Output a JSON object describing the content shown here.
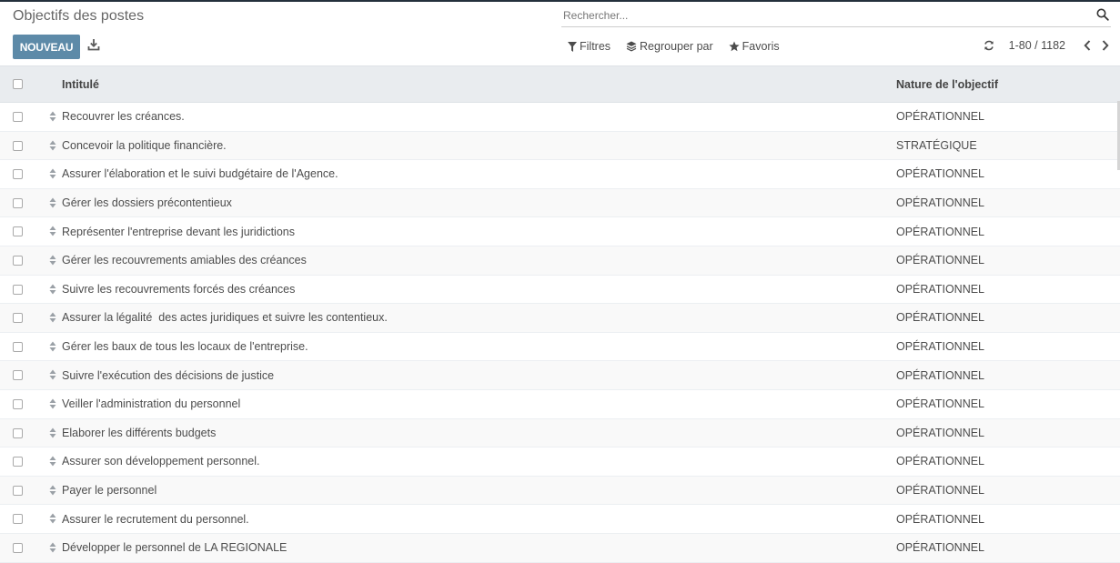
{
  "page": {
    "title": "Objectifs des postes"
  },
  "search": {
    "placeholder": "Rechercher..."
  },
  "toolbar": {
    "new_label": "NOUVEAU"
  },
  "filters": {
    "filters_label": "Filtres",
    "group_label": "Regrouper par",
    "favorites_label": "Favoris"
  },
  "pager": {
    "range": "1-80 / 1182"
  },
  "table": {
    "col_title": "Intitulé",
    "col_nature": "Nature de l'objectif",
    "rows": [
      {
        "title": "Recouvrer les créances.",
        "nature": "OPÉRATIONNEL"
      },
      {
        "title": "Concevoir la politique financière.",
        "nature": "STRATÉGIQUE"
      },
      {
        "title": "Assurer l'élaboration et le suivi budgétaire de l'Agence.",
        "nature": "OPÉRATIONNEL"
      },
      {
        "title": "Gérer les dossiers précontentieux",
        "nature": "OPÉRATIONNEL"
      },
      {
        "title": "Représenter l'entreprise devant les juridictions",
        "nature": "OPÉRATIONNEL"
      },
      {
        "title": "Gérer les recouvrements amiables des créances",
        "nature": "OPÉRATIONNEL"
      },
      {
        "title": "Suivre les recouvrements forcés des créances",
        "nature": "OPÉRATIONNEL"
      },
      {
        "title": "Assurer la légalité  des actes juridiques et suivre les contentieux.",
        "nature": "OPÉRATIONNEL"
      },
      {
        "title": "Gérer les baux de tous les locaux de l'entreprise.",
        "nature": "OPÉRATIONNEL"
      },
      {
        "title": "Suivre l'exécution des décisions de justice",
        "nature": "OPÉRATIONNEL"
      },
      {
        "title": "Veiller l'administration du personnel",
        "nature": "OPÉRATIONNEL"
      },
      {
        "title": "Elaborer les différents budgets",
        "nature": "OPÉRATIONNEL"
      },
      {
        "title": "Assurer son développement personnel.",
        "nature": "OPÉRATIONNEL"
      },
      {
        "title": "Payer le personnel",
        "nature": "OPÉRATIONNEL"
      },
      {
        "title": "Assurer le recrutement du personnel.",
        "nature": "OPÉRATIONNEL"
      },
      {
        "title": "Développer le personnel de LA REGIONALE",
        "nature": "OPÉRATIONNEL"
      }
    ]
  },
  "icons": {
    "search": "search-icon",
    "download": "download-icon",
    "filter": "funnel-icon",
    "group": "layers-icon",
    "favorites": "star-icon",
    "reload": "refresh-icon",
    "prev": "chevron-left-icon",
    "next": "chevron-right-icon",
    "handle": "drag-handle-icon"
  },
  "colors": {
    "primary_button": "#5d8aa8",
    "header_bg": "#e9ecef",
    "top_bar": "#24303c"
  }
}
